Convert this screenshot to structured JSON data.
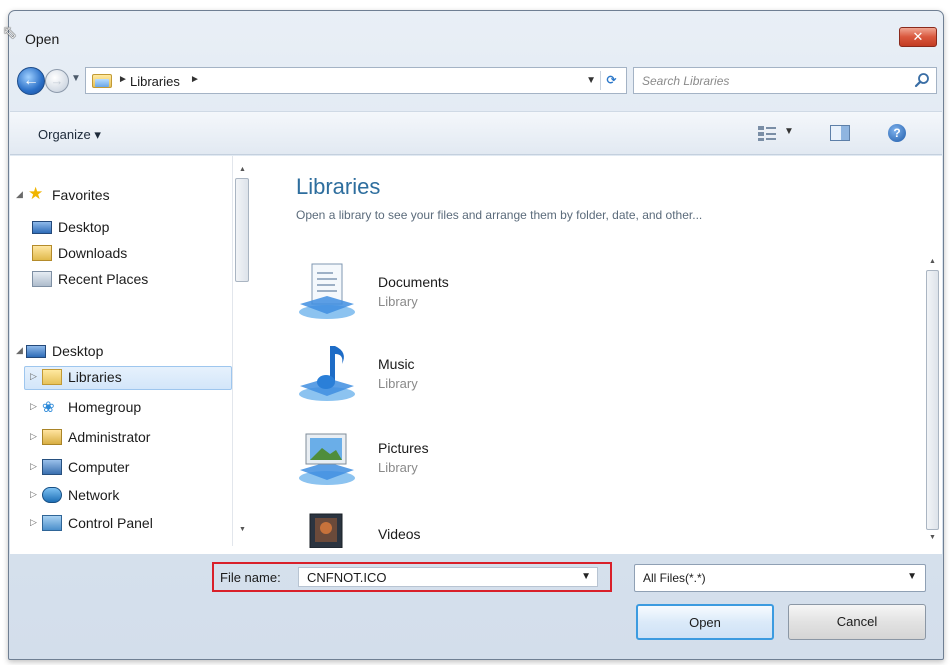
{
  "window": {
    "title": "Open",
    "close_label": "✕"
  },
  "address": {
    "breadcrumb": "Libraries",
    "search_placeholder": "Search Libraries"
  },
  "toolbar": {
    "organize_label": "Organize ▾"
  },
  "navpane": {
    "items": [
      {
        "label": "Favorites",
        "icon": "star-icon"
      },
      {
        "label": "Desktop",
        "icon": "desktop-icon"
      },
      {
        "label": "Downloads",
        "icon": "downloads-folder-icon"
      },
      {
        "label": "Recent Places",
        "icon": "recent-places-icon"
      },
      {
        "label": "Desktop",
        "icon": "desktop-icon"
      },
      {
        "label": "Libraries",
        "icon": "libraries-folder-icon",
        "selected": true
      },
      {
        "label": "Homegroup",
        "icon": "homegroup-icon"
      },
      {
        "label": "Administrator",
        "icon": "user-folder-icon"
      },
      {
        "label": "Computer",
        "icon": "computer-icon"
      },
      {
        "label": "Network",
        "icon": "network-icon"
      },
      {
        "label": "Control Panel",
        "icon": "control-panel-icon"
      }
    ]
  },
  "main": {
    "title": "Libraries",
    "subtitle": "Open a library to see your files and arrange them by folder, date, and other...",
    "libraries": [
      {
        "name": "Documents",
        "type": "Library",
        "icon": "documents-library-icon"
      },
      {
        "name": "Music",
        "type": "Library",
        "icon": "music-library-icon"
      },
      {
        "name": "Pictures",
        "type": "Library",
        "icon": "pictures-library-icon"
      },
      {
        "name": "Videos",
        "type": "",
        "icon": "videos-library-icon"
      }
    ]
  },
  "footer": {
    "filename_label": "File name:",
    "filename_value": "CNFNOT.ICO",
    "filetype_value": "All Files(*.*)",
    "open_label": "Open",
    "cancel_label": "Cancel"
  },
  "colors": {
    "highlight_box": "#d9202a",
    "title_blue": "#2e6e9e"
  }
}
